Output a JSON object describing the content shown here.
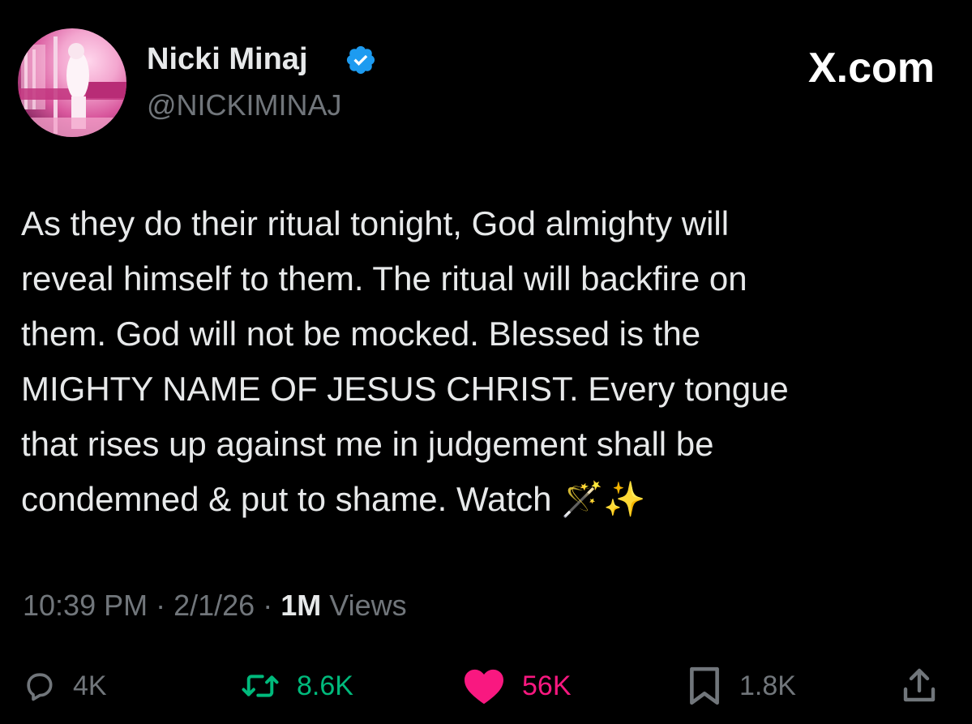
{
  "header": {
    "display_name": "Nicki Minaj",
    "handle": "@NICKIMINAJ",
    "brand": "X.com"
  },
  "tweet": {
    "lines": [
      "As they do their ritual tonight, God almighty will",
      "reveal himself to them. The ritual will backfire on",
      "them. God will not be mocked. Blessed is the",
      "MIGHTY NAME OF JESUS CHRIST. Every tongue",
      "that rises up against me in judgement shall be",
      "condemned & put to shame. Watch 🪄✨"
    ]
  },
  "meta": {
    "time": "10:39 PM",
    "separator": " · ",
    "date": "2/1/26",
    "views_count": "1M",
    "views_label": " Views"
  },
  "actions": {
    "reply_count": "4K",
    "repost_count": "8.6K",
    "like_count": "56K",
    "bookmark_count": "1.8K"
  },
  "icons": {
    "verified": "verified-badge-icon",
    "reply": "speech-bubble-icon",
    "repost": "repost-arrows-icon",
    "like": "heart-icon",
    "bookmark": "bookmark-icon",
    "share": "share-upload-icon"
  },
  "colors": {
    "background": "#000000",
    "text": "#e7e9ea",
    "secondary": "#71767b",
    "verified": "#1d9bf0",
    "repost": "#00ba7c",
    "like": "#f91880"
  }
}
